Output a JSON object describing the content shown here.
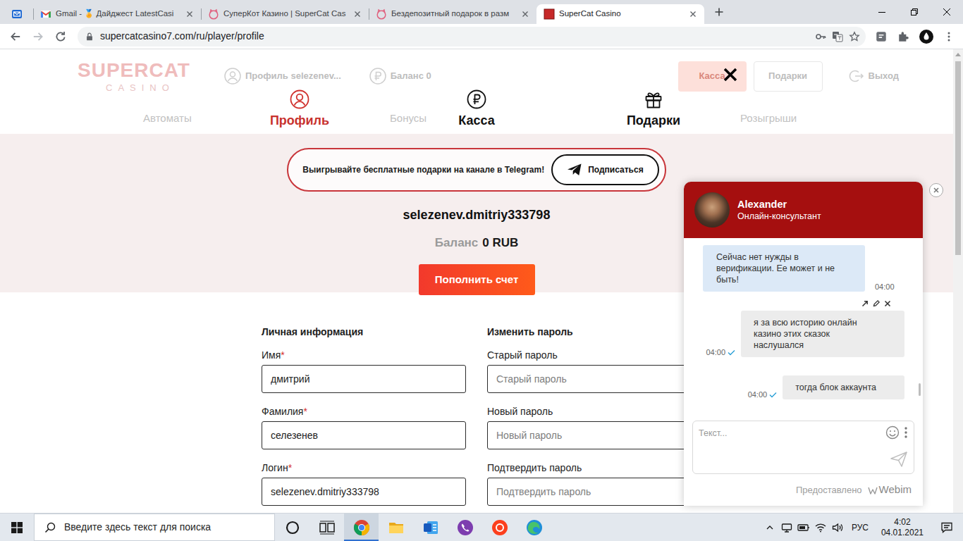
{
  "browser": {
    "pinned_tab": {
      "selected": false
    },
    "tabs": [
      {
        "label": "Gmail - 🏅 Дайджест LatestCasi",
        "kind": "gmail",
        "selected": false
      },
      {
        "label": "СуперКот Казино | SuperCat Cas",
        "kind": "cat",
        "selected": false
      },
      {
        "label": "Бездепозитный подарок в разм",
        "kind": "cat",
        "selected": false
      },
      {
        "label": "SuperCat Casino",
        "kind": "square",
        "selected": true
      }
    ],
    "url": "supercatcasino7.com/ru/player/profile"
  },
  "site": {
    "logo": {
      "word": "SUPERCAT",
      "sub": "CASINO"
    },
    "header": {
      "profile": "Профиль selezenev...",
      "balance": "Баланс 0",
      "cashier": "Касса",
      "gifts": "Подарки",
      "logout": "Выход"
    },
    "nav": [
      "Автоматы",
      "Бонусы",
      "Розыгрыши"
    ]
  },
  "modal": {
    "tabs": [
      {
        "label": "Профиль",
        "selected": true
      },
      {
        "label": "Касса",
        "selected": false
      },
      {
        "label": "Подарки",
        "selected": false
      }
    ],
    "banner": {
      "text": "Выигрывайте бесплатные подарки на канале в Telegram!",
      "button": "Подписаться"
    },
    "username": "selezenev.dmitriy333798",
    "balance": {
      "label": "Баланс",
      "value": "0 RUB"
    },
    "deposit_button": "Пополнить счет",
    "personal": {
      "title": "Личная информация",
      "fields": [
        {
          "label": "Имя",
          "asterisk": "*",
          "value": "дмитрий"
        },
        {
          "label": "Фамилия",
          "asterisk": "*",
          "value": "селезенев"
        },
        {
          "label": "Логин",
          "asterisk": "*",
          "value": "selezenev.dmitriy333798"
        }
      ]
    },
    "password": {
      "title": "Изменить пароль",
      "fields": [
        {
          "label": "Старый пароль",
          "placeholder": "Старый пароль"
        },
        {
          "label": "Новый пароль",
          "placeholder": "Новый пароль"
        },
        {
          "label": "Подтвердить пароль",
          "placeholder": "Подтвердить пароль"
        }
      ]
    }
  },
  "chat": {
    "operator": {
      "name": "Alexander",
      "role": "Онлайн-консультант"
    },
    "messages": [
      {
        "kind": "operator",
        "text": "Сейчас нет нужды в верификации. Ее может и не быть!",
        "time": "04:00"
      },
      {
        "kind": "visitor",
        "text": "я за всю историю онлайн казино этих сказок наслушался",
        "time": "04:00",
        "read": true,
        "hovered": true
      },
      {
        "kind": "visitor",
        "text": "тогда блок аккаунта",
        "time": "04:00",
        "read": true,
        "hovered": false
      }
    ],
    "input": {
      "placeholder": "Текст..."
    },
    "footer": "Предоставлено",
    "brand": "Webim"
  },
  "taskbar": {
    "search": {
      "placeholder": "Введите здесь текст для поиска"
    },
    "apps": [
      {
        "kind": "cortana",
        "selected": false
      },
      {
        "kind": "taskview",
        "selected": false
      },
      {
        "kind": "chrome",
        "selected": true
      },
      {
        "kind": "explorer",
        "selected": false
      },
      {
        "kind": "word",
        "selected": false
      },
      {
        "kind": "viber",
        "selected": false
      },
      {
        "kind": "yandex",
        "selected": false
      },
      {
        "kind": "edge",
        "selected": false
      }
    ],
    "language": "РУС",
    "time": "4:02",
    "date": "04.01.2021"
  }
}
